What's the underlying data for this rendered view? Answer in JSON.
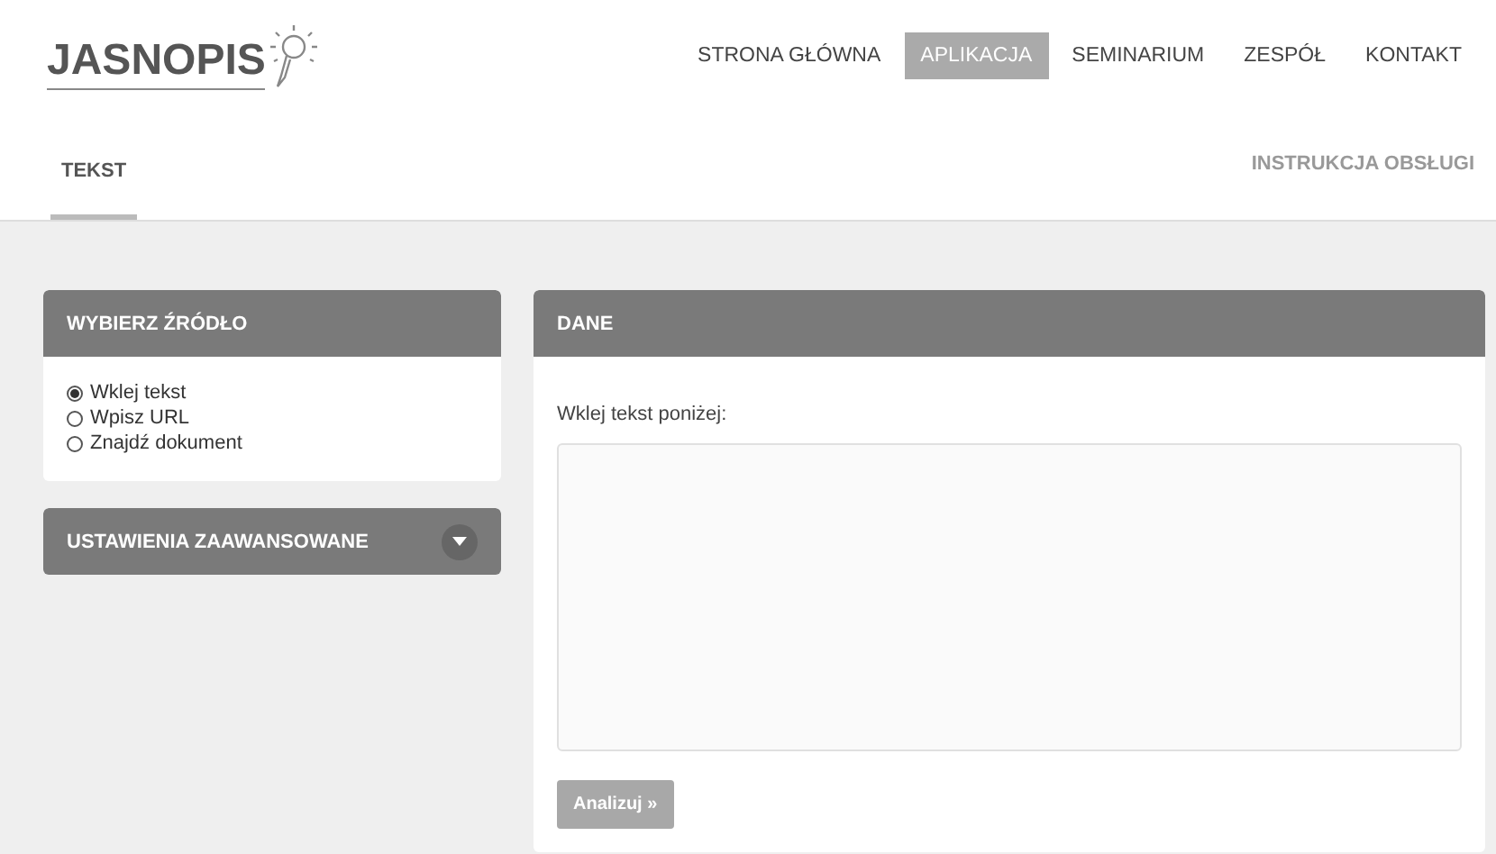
{
  "logo": {
    "text": "JASNOPIS"
  },
  "nav": [
    {
      "label": "STRONA GŁÓWNA",
      "selected": false
    },
    {
      "label": "APLIKACJA",
      "selected": true
    },
    {
      "label": "SEMINARIUM",
      "selected": false
    },
    {
      "label": "ZESPÓŁ",
      "selected": false
    },
    {
      "label": "KONTAKT",
      "selected": false
    }
  ],
  "subnav": {
    "tabs": [
      {
        "label": "TEKST",
        "selected": true
      }
    ],
    "link": "INSTRUKCJA OBSŁUGI"
  },
  "source_panel": {
    "title": "WYBIERZ ŹRÓDŁO",
    "options": [
      {
        "label": "Wklej tekst",
        "selected": true
      },
      {
        "label": "Wpisz URL",
        "selected": false
      },
      {
        "label": "Znajdź dokument",
        "selected": false
      }
    ]
  },
  "advanced_panel": {
    "title": "USTAWIENIA ZAAWANSOWANE",
    "expanded": false
  },
  "data_panel": {
    "title": "DANE",
    "label": "Wklej tekst poniżej:",
    "button": "Analizuj »"
  }
}
